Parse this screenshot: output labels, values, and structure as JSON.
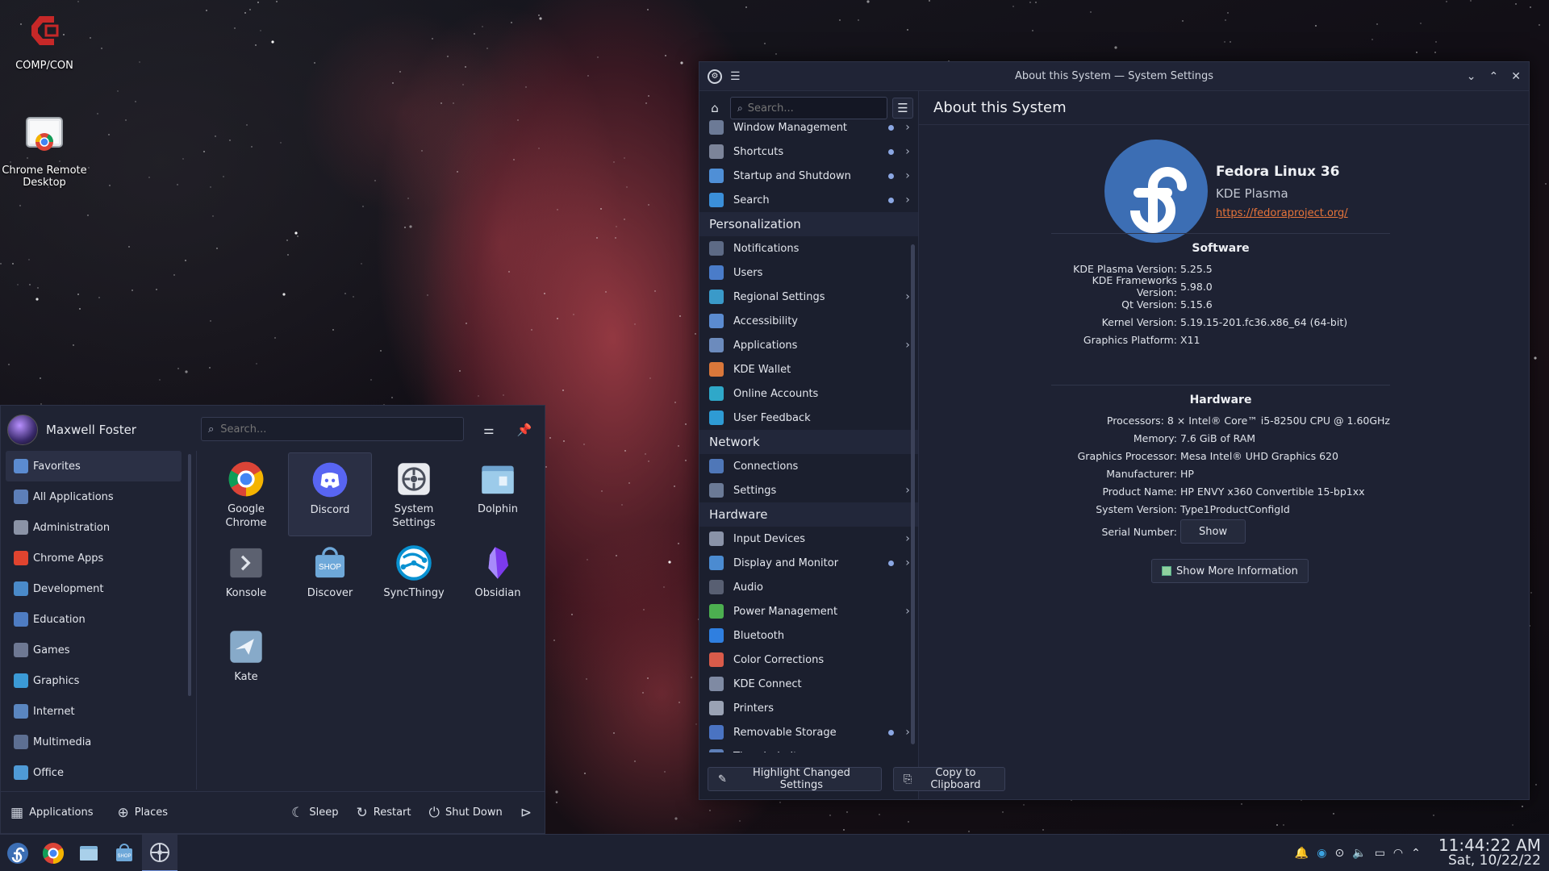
{
  "desktop": {
    "icons": [
      {
        "label": "COMP/CON"
      },
      {
        "label": "Chrome Remote Desktop"
      }
    ]
  },
  "settings_window": {
    "title": "About this System — System Settings",
    "search_placeholder": "Search...",
    "page_title": "About this System",
    "sidebar": {
      "items": [
        {
          "type": "item",
          "label": "Window Management",
          "dot": true,
          "chevron": true,
          "color": "#6c7a96"
        },
        {
          "type": "item",
          "label": "Shortcuts",
          "dot": true,
          "chevron": true,
          "color": "#7c8499"
        },
        {
          "type": "item",
          "label": "Startup and Shutdown",
          "dot": true,
          "chevron": true,
          "color": "#4f8fd6"
        },
        {
          "type": "item",
          "label": "Search",
          "dot": true,
          "chevron": true,
          "color": "#3b8fd9"
        },
        {
          "type": "header",
          "label": "Personalization"
        },
        {
          "type": "item",
          "label": "Notifications",
          "dot": false,
          "chevron": false,
          "color": "#5d6a85"
        },
        {
          "type": "item",
          "label": "Users",
          "dot": false,
          "chevron": false,
          "color": "#4a7cc9"
        },
        {
          "type": "item",
          "label": "Regional Settings",
          "dot": false,
          "chevron": true,
          "color": "#3a9ac9"
        },
        {
          "type": "item",
          "label": "Accessibility",
          "dot": false,
          "chevron": false,
          "color": "#5b8bd0"
        },
        {
          "type": "item",
          "label": "Applications",
          "dot": false,
          "chevron": true,
          "color": "#6c8bbd"
        },
        {
          "type": "item",
          "label": "KDE Wallet",
          "dot": false,
          "chevron": false,
          "color": "#d9773a"
        },
        {
          "type": "item",
          "label": "Online Accounts",
          "dot": false,
          "chevron": false,
          "color": "#2fa8c9"
        },
        {
          "type": "item",
          "label": "User Feedback",
          "dot": false,
          "chevron": false,
          "color": "#2e9bd4"
        },
        {
          "type": "header",
          "label": "Network"
        },
        {
          "type": "item",
          "label": "Connections",
          "dot": false,
          "chevron": false,
          "color": "#4f77b8"
        },
        {
          "type": "item",
          "label": "Settings",
          "dot": false,
          "chevron": true,
          "color": "#6b7a96"
        },
        {
          "type": "header",
          "label": "Hardware"
        },
        {
          "type": "item",
          "label": "Input Devices",
          "dot": false,
          "chevron": true,
          "color": "#8a93a8"
        },
        {
          "type": "item",
          "label": "Display and Monitor",
          "dot": true,
          "chevron": true,
          "color": "#4b8bd1"
        },
        {
          "type": "item",
          "label": "Audio",
          "dot": false,
          "chevron": false,
          "color": "#585f72"
        },
        {
          "type": "item",
          "label": "Power Management",
          "dot": false,
          "chevron": true,
          "color": "#4caf50"
        },
        {
          "type": "item",
          "label": "Bluetooth",
          "dot": false,
          "chevron": false,
          "color": "#2f7fe0"
        },
        {
          "type": "item",
          "label": "Color Corrections",
          "dot": false,
          "chevron": false,
          "color": "#d95b4a"
        },
        {
          "type": "item",
          "label": "KDE Connect",
          "dot": false,
          "chevron": false,
          "color": "#7f8aa3"
        },
        {
          "type": "item",
          "label": "Printers",
          "dot": false,
          "chevron": false,
          "color": "#9aa2b4"
        },
        {
          "type": "item",
          "label": "Removable Storage",
          "dot": true,
          "chevron": true,
          "color": "#4a73c2"
        },
        {
          "type": "item",
          "label": "Thunderbolt",
          "dot": false,
          "chevron": false,
          "color": "#5e7fb8"
        }
      ],
      "highlight_button": "Highlight Changed Settings",
      "copy_button": "Copy to Clipboard"
    },
    "distro": {
      "name": "Fedora Linux 36",
      "desktop": "KDE Plasma",
      "url": "https://fedoraproject.org/"
    },
    "software": {
      "title": "Software",
      "rows": [
        {
          "key": "KDE Plasma Version:",
          "value": "5.25.5"
        },
        {
          "key": "KDE Frameworks Version:",
          "value": "5.98.0"
        },
        {
          "key": "Qt Version:",
          "value": "5.15.6"
        },
        {
          "key": "Kernel Version:",
          "value": "5.19.15-201.fc36.x86_64 (64-bit)"
        },
        {
          "key": "Graphics Platform:",
          "value": "X11"
        }
      ]
    },
    "hardware": {
      "title": "Hardware",
      "rows": [
        {
          "key": "Processors:",
          "value": "8 × Intel® Core™ i5-8250U CPU @ 1.60GHz"
        },
        {
          "key": "Memory:",
          "value": "7.6 GiB of RAM"
        },
        {
          "key": "Graphics Processor:",
          "value": "Mesa Intel® UHD Graphics 620"
        },
        {
          "key": "Manufacturer:",
          "value": "HP"
        },
        {
          "key": "Product Name:",
          "value": "HP ENVY x360 Convertible 15-bp1xx"
        },
        {
          "key": "System Version:",
          "value": "Type1ProductConfigId"
        }
      ],
      "serial_key": "Serial Number:",
      "serial_button": "Show"
    },
    "show_more_button": "Show More Information"
  },
  "launcher": {
    "user_name": "Maxwell Foster",
    "search_placeholder": "Search...",
    "categories": [
      {
        "label": "Favorites",
        "active": true,
        "color": "#5b8bd0"
      },
      {
        "label": "All Applications",
        "active": false,
        "color": "#5d7fb8"
      },
      {
        "label": "Administration",
        "active": false,
        "color": "#8b93a6"
      },
      {
        "label": "Chrome Apps",
        "active": false,
        "color": "#e0442f"
      },
      {
        "label": "Development",
        "active": false,
        "color": "#4a8ac9"
      },
      {
        "label": "Education",
        "active": false,
        "color": "#4e7cc2"
      },
      {
        "label": "Games",
        "active": false,
        "color": "#6e7893"
      },
      {
        "label": "Graphics",
        "active": false,
        "color": "#3b9ad6"
      },
      {
        "label": "Internet",
        "active": false,
        "color": "#5a86c0"
      },
      {
        "label": "Multimedia",
        "active": false,
        "color": "#5d6f92"
      },
      {
        "label": "Office",
        "active": false,
        "color": "#4f9ad6"
      }
    ],
    "favorites": [
      {
        "label": "Google Chrome",
        "icon": "chrome-icon",
        "active": false
      },
      {
        "label": "Discord",
        "icon": "discord-icon",
        "active": true
      },
      {
        "label": "System Settings",
        "icon": "system-settings-icon",
        "active": false
      },
      {
        "label": "Dolphin",
        "icon": "dolphin-icon",
        "active": false
      },
      {
        "label": "Konsole",
        "icon": "konsole-icon",
        "active": false
      },
      {
        "label": "Discover",
        "icon": "discover-icon",
        "active": false
      },
      {
        "label": "SyncThingy",
        "icon": "syncthingy-icon",
        "active": false
      },
      {
        "label": "Obsidian",
        "icon": "obsidian-icon",
        "active": false
      },
      {
        "label": "Kate",
        "icon": "kate-icon",
        "active": false
      }
    ],
    "footer": {
      "applications": "Applications",
      "places": "Places",
      "sleep": "Sleep",
      "restart": "Restart",
      "shutdown": "Shut Down"
    }
  },
  "taskbar": {
    "time": "11:44:22 AM",
    "date": "Sat, 10/22/22"
  }
}
